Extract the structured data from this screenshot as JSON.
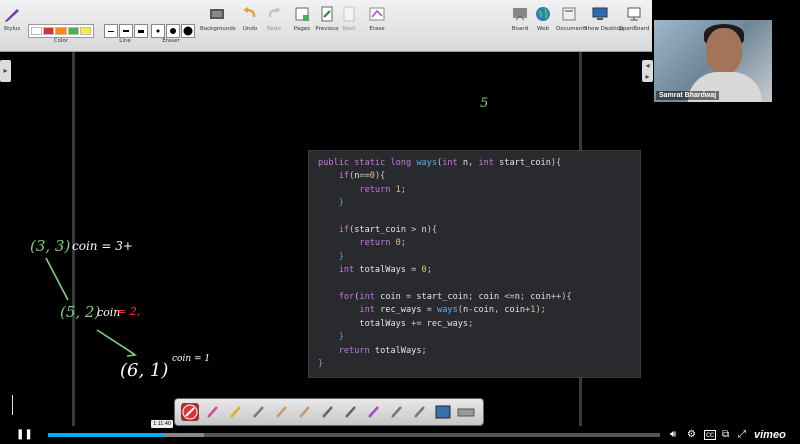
{
  "toolbar": {
    "items": [
      {
        "label": "Stylus",
        "icon": "stylus-icon"
      },
      {
        "label": "Color",
        "icon": "color-palette-icon"
      },
      {
        "label": "Line",
        "icon": "line-width-icon"
      },
      {
        "label": "Eraser",
        "icon": "eraser-size-icon"
      },
      {
        "label": "Backgrounds",
        "icon": "backgrounds-icon"
      },
      {
        "label": "Undo",
        "icon": "undo-icon"
      },
      {
        "label": "Redo",
        "icon": "redo-icon"
      },
      {
        "label": "Pages",
        "icon": "pages-icon"
      },
      {
        "label": "Previous",
        "icon": "previous-page-icon"
      },
      {
        "label": "Next",
        "icon": "next-page-icon"
      },
      {
        "label": "Erase",
        "icon": "erase-all-icon"
      },
      {
        "label": "Board",
        "icon": "board-icon"
      },
      {
        "label": "Web",
        "icon": "globe-icon"
      },
      {
        "label": "Documents",
        "icon": "documents-icon"
      },
      {
        "label": "Show Desktop",
        "icon": "desktop-icon"
      },
      {
        "label": "OpenBoard",
        "icon": "openboard-icon"
      }
    ],
    "colors": [
      "#ffffff",
      "#e03131",
      "#ff8c00",
      "#4caf50",
      "#ffeb3b"
    ]
  },
  "webcam": {
    "name": "Samrat Bhardwaj"
  },
  "code": {
    "lines": [
      [
        [
          "kw",
          "public "
        ],
        [
          "kw",
          "static "
        ],
        [
          "ty",
          "long "
        ],
        [
          "fn",
          "ways"
        ],
        [
          "op",
          "("
        ],
        [
          "ty",
          "int "
        ],
        [
          "id",
          "n"
        ],
        [
          "op",
          ", "
        ],
        [
          "ty",
          "int "
        ],
        [
          "id",
          "start_coin"
        ],
        [
          "op",
          "){"
        ]
      ],
      [
        [
          "op",
          "    "
        ],
        [
          "kw",
          "if"
        ],
        [
          "op",
          "("
        ],
        [
          "id",
          "n"
        ],
        [
          "op",
          "=="
        ],
        [
          "nm",
          "0"
        ],
        [
          "op",
          "){"
        ]
      ],
      [
        [
          "op",
          "        "
        ],
        [
          "kw",
          "return "
        ],
        [
          "nm",
          "1"
        ],
        [
          "op",
          ";"
        ]
      ],
      [
        [
          "op",
          "    "
        ],
        [
          "br",
          "}"
        ]
      ],
      [
        [
          "op",
          ""
        ]
      ],
      [
        [
          "op",
          "    "
        ],
        [
          "kw",
          "if"
        ],
        [
          "op",
          "("
        ],
        [
          "id",
          "start_coin"
        ],
        [
          "op",
          " > "
        ],
        [
          "id",
          "n"
        ],
        [
          "op",
          "){"
        ]
      ],
      [
        [
          "op",
          "        "
        ],
        [
          "kw",
          "return "
        ],
        [
          "nm",
          "0"
        ],
        [
          "op",
          ";"
        ]
      ],
      [
        [
          "op",
          "    "
        ],
        [
          "br",
          "}"
        ]
      ],
      [
        [
          "op",
          "    "
        ],
        [
          "ty",
          "int "
        ],
        [
          "id",
          "totalWays"
        ],
        [
          "op",
          " = "
        ],
        [
          "nm",
          "0"
        ],
        [
          "op",
          ";"
        ]
      ],
      [
        [
          "op",
          ""
        ]
      ],
      [
        [
          "op",
          "    "
        ],
        [
          "kw",
          "for"
        ],
        [
          "op",
          "("
        ],
        [
          "ty",
          "int "
        ],
        [
          "id",
          "coin"
        ],
        [
          "op",
          " = "
        ],
        [
          "id",
          "start_coin"
        ],
        [
          "op",
          "; "
        ],
        [
          "id",
          "coin"
        ],
        [
          "op",
          " <="
        ],
        [
          "id",
          "n"
        ],
        [
          "op",
          "; "
        ],
        [
          "id",
          "coin"
        ],
        [
          "op",
          "++){"
        ]
      ],
      [
        [
          "op",
          "        "
        ],
        [
          "ty",
          "int "
        ],
        [
          "id",
          "rec_ways"
        ],
        [
          "op",
          " = "
        ],
        [
          "fn",
          "ways"
        ],
        [
          "op",
          "("
        ],
        [
          "id",
          "n"
        ],
        [
          "op",
          "-"
        ],
        [
          "id",
          "coin"
        ],
        [
          "op",
          ", "
        ],
        [
          "id",
          "coin"
        ],
        [
          "op",
          "+"
        ],
        [
          "nm",
          "1"
        ],
        [
          "op",
          ");"
        ]
      ],
      [
        [
          "op",
          "        "
        ],
        [
          "id",
          "totalWays"
        ],
        [
          "op",
          " += "
        ],
        [
          "id",
          "rec_ways"
        ],
        [
          "op",
          ";"
        ]
      ],
      [
        [
          "op",
          "    "
        ],
        [
          "br",
          "}"
        ]
      ],
      [
        [
          "op",
          "    "
        ],
        [
          "kw",
          "return "
        ],
        [
          "id",
          "totalWays"
        ],
        [
          "op",
          ";"
        ]
      ],
      [
        [
          "kw",
          "}"
        ]
      ]
    ]
  },
  "handwriting": {
    "n5": "5",
    "node1": "(3, 3)",
    "node1_note": "coin = 3+",
    "node2": "(5, 2)",
    "node2_note": "coin",
    "node2_val": "= 2,",
    "node3": "(6, 1)",
    "node3_note": "coin = 1"
  },
  "player": {
    "time_tooltip": "1:11:40",
    "progress": 0.19,
    "brand": "vimeo"
  },
  "palette": {
    "tools": [
      "stop-icon",
      "eraser-icon",
      "marker-icon",
      "pointer-icon",
      "hand-point-icon",
      "hand-grab-icon",
      "zoom-in-icon",
      "zoom-out-icon",
      "pen-icon",
      "line-icon",
      "text-icon",
      "capture-icon",
      "keyboard-icon"
    ]
  }
}
